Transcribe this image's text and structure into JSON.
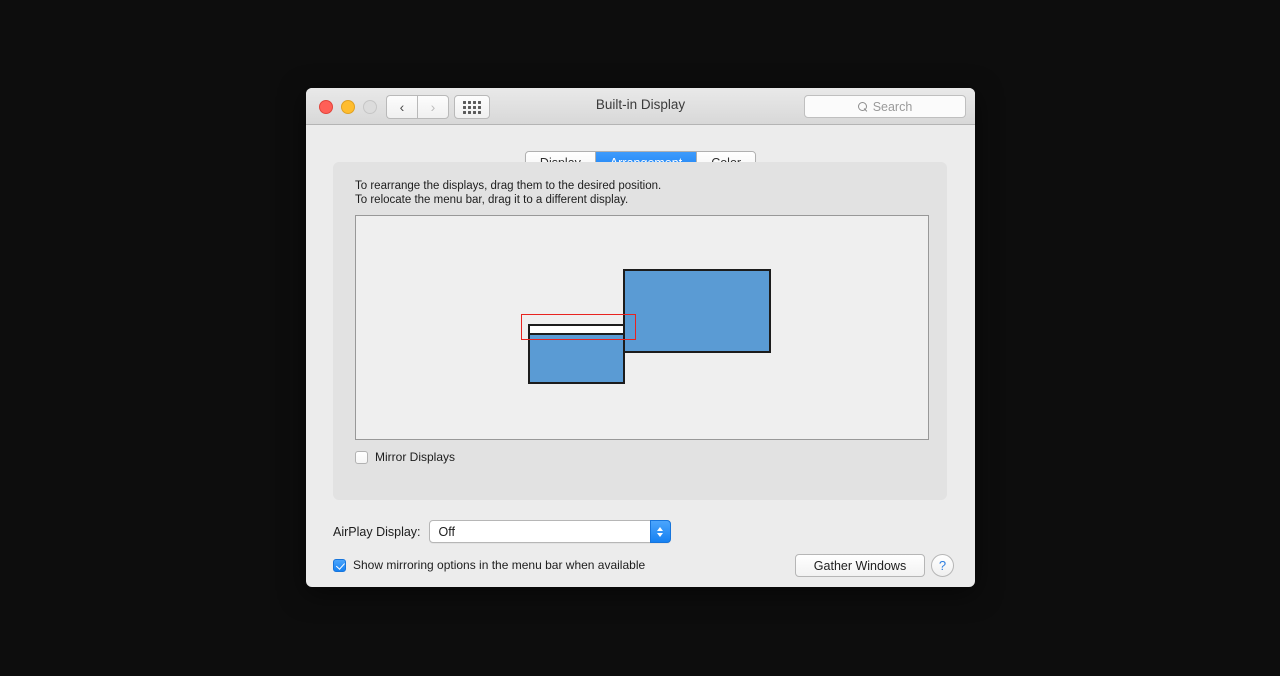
{
  "window": {
    "title": "Built-in Display",
    "traffic_lights": [
      "close",
      "minimize",
      "zoom"
    ],
    "nav": {
      "back_icon": "chevron-left-icon",
      "forward_icon": "chevron-right-icon"
    },
    "show_all_icon": "grid-dots-icon",
    "search": {
      "placeholder": "Search",
      "value": "",
      "icon": "search-icon"
    }
  },
  "tabs": [
    {
      "label": "Display",
      "active": false
    },
    {
      "label": "Arrangement",
      "active": true
    },
    {
      "label": "Color",
      "active": false
    }
  ],
  "arrangement": {
    "instruction_line1": "To rearrange the displays, drag them to the desired position.",
    "instruction_line2": "To relocate the menu bar, drag it to a different display.",
    "displays": [
      {
        "name": "left-display",
        "has_menu_bar": true,
        "color": "#5a9bd4"
      },
      {
        "name": "right-display",
        "has_menu_bar": false,
        "color": "#5a9bd4"
      }
    ],
    "selection_color": "#e8231f",
    "mirror_displays": {
      "label": "Mirror Displays",
      "checked": false
    }
  },
  "airplay": {
    "label": "AirPlay Display:",
    "value": "Off",
    "options": [
      "Off"
    ]
  },
  "footer": {
    "show_mirroring": {
      "label": "Show mirroring options in the menu bar when available",
      "checked": true
    },
    "gather_windows_label": "Gather Windows",
    "help_label": "?"
  },
  "colors": {
    "accent": "#167ef4",
    "display_fill": "#5a9bd4",
    "selection": "#e8231f",
    "window_bg": "#ececec",
    "panel_bg": "#e2e2e2"
  }
}
